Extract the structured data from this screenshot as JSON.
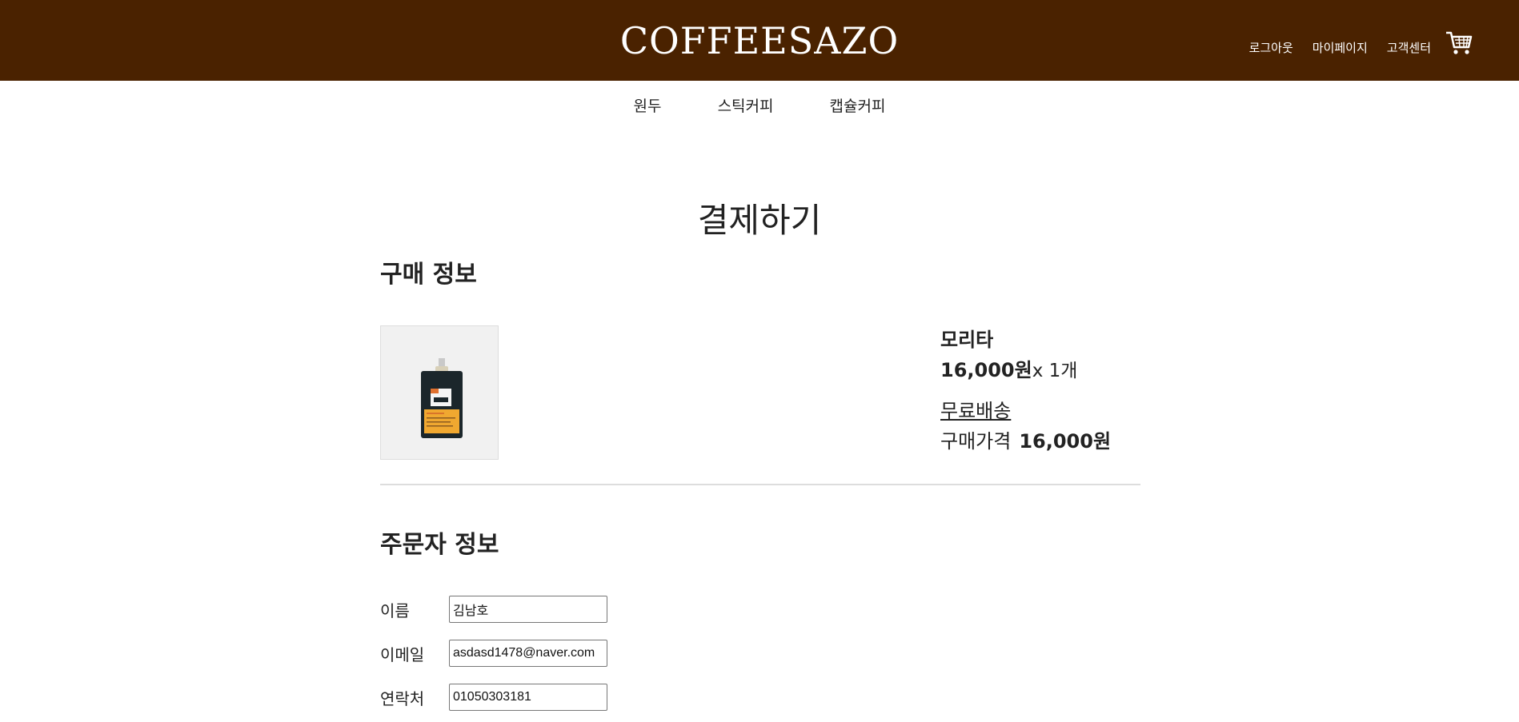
{
  "header": {
    "logo": "COFFEESAZO",
    "links": [
      "로그아웃",
      "마이페이지",
      "고객센터"
    ],
    "cart_icon": "cart-icon",
    "background": "#4a2200"
  },
  "nav": {
    "items": [
      "원두",
      "스틱커피",
      "캡슐커피"
    ]
  },
  "page": {
    "title": "결제하기"
  },
  "purchase": {
    "section_title": "구매 정보",
    "product_image_icon": "coffee-bag-product-image",
    "product_name": "모리타",
    "price": "16,000원",
    "quantity": "x 1개",
    "shipping": "무료배송",
    "total_label": "구매가격",
    "total": "16,000원"
  },
  "orderer": {
    "section_title": "주문자 정보",
    "name_label": "이름",
    "name_value": "김남호",
    "email_label": "이메일",
    "email_value": "asdasd1478@naver.com",
    "phone_label": "연락처",
    "phone_value": "01050303181"
  }
}
